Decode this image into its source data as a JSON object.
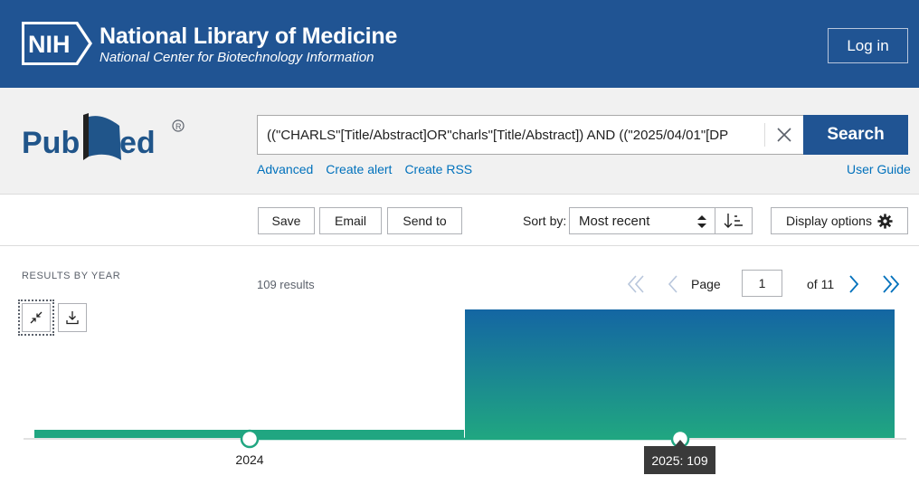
{
  "header": {
    "logo_text": "NIH",
    "title": "National Library of Medicine",
    "subtitle": "National Center for Biotechnology Information",
    "login_label": "Log in"
  },
  "search": {
    "logo_text": "PubMed",
    "query": "((\"CHARLS\"[Title/Abstract]OR\"charls\"[Title/Abstract]) AND ((\"2025/04/01\"[DP",
    "button_label": "Search",
    "links": [
      "Advanced",
      "Create alert",
      "Create RSS"
    ],
    "user_guide": "User Guide"
  },
  "toolbar": {
    "save_label": "Save",
    "email_label": "Email",
    "send_to_label": "Send to",
    "sort_label": "Sort by:",
    "sort_value": "Most recent",
    "display_options_label": "Display options"
  },
  "results": {
    "by_year_label": "RESULTS BY YEAR",
    "count_text": "109 results",
    "page_label": "Page",
    "page_current": "1",
    "page_of": "of 11"
  },
  "chart_data": {
    "type": "bar",
    "categories": [
      "2024",
      "2025"
    ],
    "values": [
      1,
      109
    ],
    "ylim": [
      0,
      109
    ],
    "xlabel": "",
    "ylabel": "",
    "tooltip": "2025: 109",
    "tick_labels": [
      "2024"
    ]
  },
  "colors": {
    "header_bg": "#205493",
    "accent_link": "#0071bc",
    "bar_top": "#1466a3",
    "bar_bottom": "#20a681",
    "axis_line": "#20a681"
  }
}
